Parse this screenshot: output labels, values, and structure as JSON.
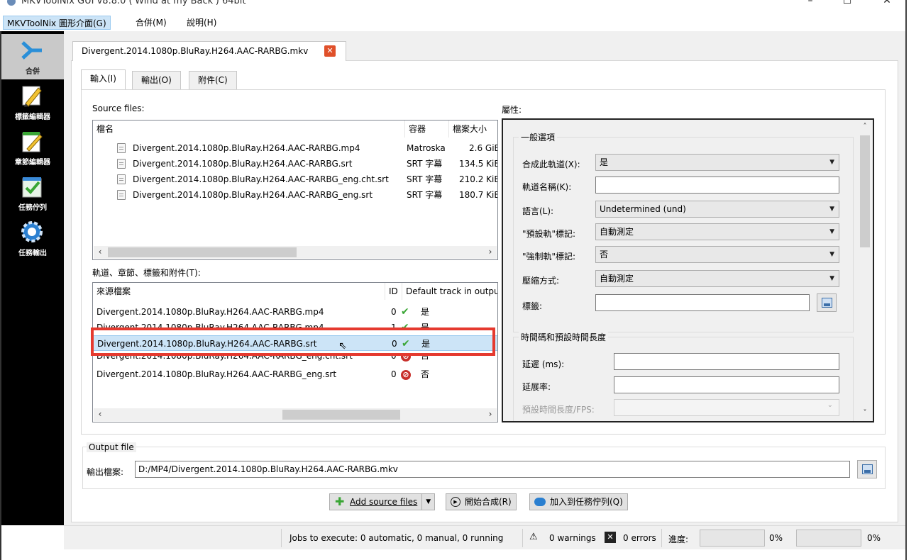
{
  "window": {
    "title": "MKVToolNix GUI v8.8.0 ('Wind at my Back') 64bit",
    "minimize": "–",
    "maximize": "☐",
    "close": "✕"
  },
  "menu": [
    "MKVToolNix 圖形介面(G)",
    "合併(M)",
    "說明(H)"
  ],
  "sidebar": [
    {
      "label": "合併",
      "icon": "merge-icon",
      "active": true
    },
    {
      "label": "標籤編輯器",
      "icon": "pencil-icon",
      "active": false
    },
    {
      "label": "章節編輯器",
      "icon": "notepad-pencil-icon",
      "active": false
    },
    {
      "label": "任務佇列",
      "icon": "checklist-icon",
      "active": false
    },
    {
      "label": "任務輸出",
      "icon": "gear-output-icon",
      "active": false
    }
  ],
  "file_tab": {
    "label": "Divergent.2014.1080p.BluRay.H264.AAC-RARBG.mkv",
    "close_icon": "close-tab-icon"
  },
  "sub_tabs": [
    "輸入(I)",
    "輸出(O)",
    "附件(C)"
  ],
  "source_files": {
    "label": "Source files:",
    "columns": [
      "檔名",
      "容器",
      "檔案大小"
    ],
    "rows": [
      {
        "name": "Divergent.2014.1080p.BluRay.H264.AAC-RARBG.mp4",
        "container": "Matroska",
        "size": "2.6 GiB"
      },
      {
        "name": "Divergent.2014.1080p.BluRay.H264.AAC-RARBG.srt",
        "container": "SRT 字幕",
        "size": "134.5 KiB"
      },
      {
        "name": "Divergent.2014.1080p.BluRay.H264.AAC-RARBG_eng.cht.srt",
        "container": "SRT 字幕",
        "size": "210.2 KiB"
      },
      {
        "name": "Divergent.2014.1080p.BluRay.H264.AAC-RARBG_eng.srt",
        "container": "SRT 字幕",
        "size": "180.7 KiB"
      }
    ]
  },
  "tracks": {
    "label": "軌道、章節、標籤和附件(T):",
    "columns": [
      "來源檔案",
      "ID",
      "Default track in output"
    ],
    "rows": [
      {
        "source": "Divergent.2014.1080p.BluRay.H264.AAC-RARBG.mp4",
        "id": "0",
        "default": "是",
        "ok": true
      },
      {
        "source": "Divergent.2014.1080p.BluRay.H264.AAC-RARBG.mp4",
        "id": "1",
        "default": "是",
        "ok": true
      },
      {
        "source": "Divergent.2014.1080p.BluRay.H264.AAC-RARBG.srt",
        "id": "0",
        "default": "是",
        "ok": true
      },
      {
        "source": "Divergent.2014.1080p.BluRay.H264.AAC-RARBG_eng.cht.srt",
        "id": "0",
        "default": "否",
        "ok": false
      },
      {
        "source": "Divergent.2014.1080p.BluRay.H264.AAC-RARBG_eng.srt",
        "id": "0",
        "default": "否",
        "ok": false
      }
    ],
    "selected_index": 2
  },
  "properties": {
    "label": "屬性:",
    "general": {
      "title": "一般選項",
      "merge_track_label": "合成此軌道(X):",
      "merge_track_value": "是",
      "track_name_label": "軌道名稱(K):",
      "track_name_value": "",
      "language_label": "語言(L):",
      "language_value": "Undetermined (und)",
      "default_flag_label": "\"預設軌\"標記:",
      "default_flag_value": "自動測定",
      "forced_flag_label": "\"強制軌\"標記:",
      "forced_flag_value": "否",
      "compression_label": "壓縮方式:",
      "compression_value": "自動測定",
      "tags_label": "標籤:",
      "tags_value": ""
    },
    "timing": {
      "title": "時間碼和預設時間長度",
      "delay_label": "延遲 (ms):",
      "stretch_label": "延展率:",
      "duration_label": "預設時間長度/FPS:"
    }
  },
  "output": {
    "group_title": "Output file",
    "file_label": "輸出檔案:",
    "file_value": "D:/MP4/Divergent.2014.1080p.BluRay.H264.AAC-RARBG.mkv"
  },
  "actions": {
    "add_source": "Add source files",
    "start_merge": "開始合成(R)",
    "add_to_queue": "加入到任務佇列(Q)"
  },
  "status": {
    "jobs": "Jobs to execute:  0 automatic, 0 manual, 0 running",
    "warnings": "0 warnings",
    "errors": "0 errors",
    "progress_label": "進度:",
    "progress_1": "0%",
    "progress_2": "0%",
    "progress_1_value": 0,
    "progress_2_value": 0
  },
  "colors": {
    "highlight": "#e53a2f",
    "selection": "#cce4f7",
    "sidebar_bg": "#000000",
    "check": "#3aa635",
    "deny": "#c8302b"
  }
}
